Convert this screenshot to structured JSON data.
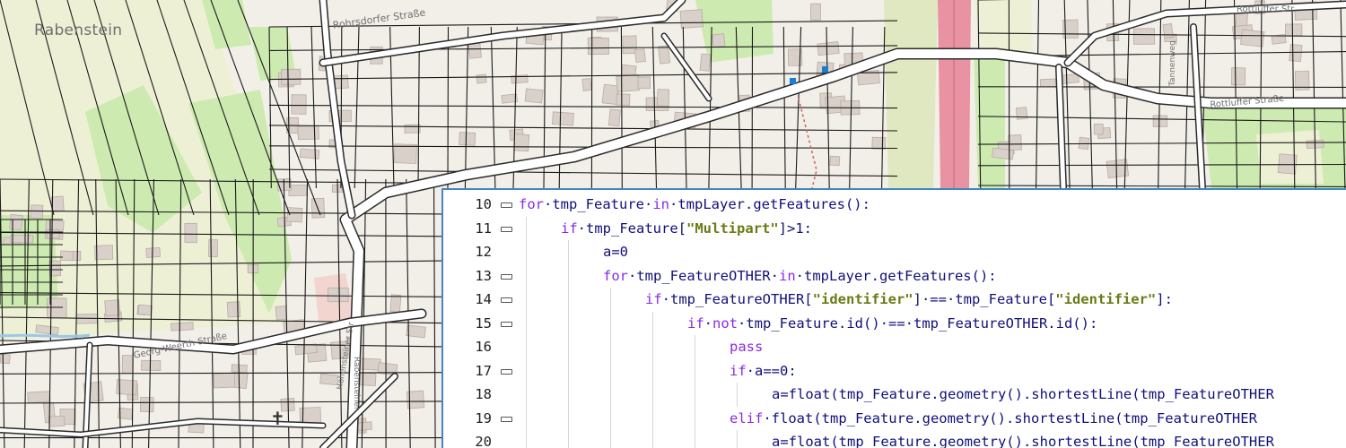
{
  "map": {
    "place_name": "Rabenstein",
    "street_labels": {
      "s1": "Rohrsdorfer Straße",
      "s2": "Rottluffer Straße",
      "s3": "Rottluffer Str",
      "s4": "Georg-Weerth-Straße",
      "s5": "Rabensteiner",
      "s6": "Hohensteiner Str",
      "s7": "Tannenweg"
    },
    "church_symbol": "✝",
    "colors": {
      "background": "#f2efe9",
      "building": "#d9d0c9",
      "road": "#ffffff",
      "road_casing": "#2b2b2b",
      "meadow": "#cdebb0",
      "farmland": "#eef0d5",
      "motorway": "#e892a2",
      "parcel_line": "#1a1a1a"
    }
  },
  "editor": {
    "accent": "#3f88c5",
    "lines": [
      {
        "n": "10",
        "fold": true,
        "indent": 0,
        "tokens": [
          [
            "kw",
            "for"
          ],
          [
            "t",
            "·tmp_Feature·"
          ],
          [
            "kw",
            "in"
          ],
          [
            "t",
            "·tmpLayer.getFeatures():"
          ]
        ]
      },
      {
        "n": "11",
        "fold": true,
        "indent": 1,
        "tokens": [
          [
            "kw",
            "if"
          ],
          [
            "t",
            "·tmp_Feature["
          ],
          [
            "str",
            "\"Multipart\""
          ],
          [
            "t",
            "]>1:"
          ]
        ]
      },
      {
        "n": "12",
        "fold": false,
        "indent": 2,
        "tokens": [
          [
            "t",
            "a=0"
          ]
        ]
      },
      {
        "n": "13",
        "fold": true,
        "indent": 2,
        "tokens": [
          [
            "kw",
            "for"
          ],
          [
            "t",
            "·tmp_FeatureOTHER·"
          ],
          [
            "kw",
            "in"
          ],
          [
            "t",
            "·tmpLayer.getFeatures():"
          ]
        ]
      },
      {
        "n": "14",
        "fold": true,
        "indent": 3,
        "tokens": [
          [
            "kw",
            "if"
          ],
          [
            "t",
            "·tmp_FeatureOTHER["
          ],
          [
            "str",
            "\"identifier\""
          ],
          [
            "t",
            "]·==·tmp_Feature["
          ],
          [
            "str",
            "\"identifier\""
          ],
          [
            "t",
            "]:"
          ]
        ]
      },
      {
        "n": "15",
        "fold": true,
        "indent": 4,
        "tokens": [
          [
            "kw",
            "if"
          ],
          [
            "t",
            "·"
          ],
          [
            "kw",
            "not"
          ],
          [
            "t",
            "·tmp_Feature.id()·==·tmp_FeatureOTHER.id():"
          ]
        ]
      },
      {
        "n": "16",
        "fold": false,
        "indent": 5,
        "tokens": [
          [
            "kw",
            "pass"
          ]
        ]
      },
      {
        "n": "17",
        "fold": true,
        "indent": 5,
        "tokens": [
          [
            "kw",
            "if"
          ],
          [
            "t",
            "·a==0:"
          ]
        ]
      },
      {
        "n": "18",
        "fold": false,
        "indent": 6,
        "tokens": [
          [
            "t",
            "a=float(tmp_Feature.geometry().shortestLine(tmp_FeatureOTHER"
          ]
        ]
      },
      {
        "n": "19",
        "fold": true,
        "indent": 5,
        "tokens": [
          [
            "kw",
            "elif"
          ],
          [
            "t",
            "·float(tmp_Feature.geometry().shortestLine(tmp_FeatureOTHER"
          ]
        ]
      },
      {
        "n": "20",
        "fold": false,
        "indent": 6,
        "tokens": [
          [
            "t",
            "a=float(tmp_Feature.geometry().shortestLine(tmp_FeatureOTHER"
          ]
        ]
      }
    ]
  }
}
